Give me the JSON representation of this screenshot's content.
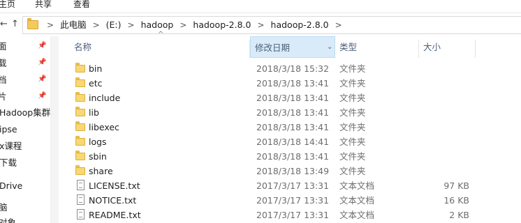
{
  "ribbon": {
    "tabs": [
      "主页",
      "共享",
      "查看"
    ]
  },
  "nav": {
    "back": "←",
    "up": "↑"
  },
  "address": {
    "crumbs": [
      "此电脑",
      "(E:)",
      "hadoop",
      "hadoop-2.8.0",
      "hadoop-2.8.0"
    ],
    "separator": ">"
  },
  "sidebar": {
    "items": [
      "面",
      "载",
      "档",
      "片",
      "Hadoop集群",
      "ipse",
      "x课程",
      "下载",
      "Drive",
      "脑",
      "对象"
    ],
    "pin_glyph": "📌"
  },
  "columns": {
    "name": "名称",
    "date": "修改日期",
    "type": "类型",
    "size": "大小",
    "sort_glyph": "^",
    "dropdown_glyph": "⌄"
  },
  "files": [
    {
      "name": "bin",
      "date": "2018/3/18 15:32",
      "type": "文件夹",
      "size": "",
      "kind": "folder"
    },
    {
      "name": "etc",
      "date": "2018/3/18 13:41",
      "type": "文件夹",
      "size": "",
      "kind": "folder"
    },
    {
      "name": "include",
      "date": "2018/3/18 13:41",
      "type": "文件夹",
      "size": "",
      "kind": "folder"
    },
    {
      "name": "lib",
      "date": "2018/3/18 13:41",
      "type": "文件夹",
      "size": "",
      "kind": "folder"
    },
    {
      "name": "libexec",
      "date": "2018/3/18 13:41",
      "type": "文件夹",
      "size": "",
      "kind": "folder"
    },
    {
      "name": "logs",
      "date": "2018/3/18 14:41",
      "type": "文件夹",
      "size": "",
      "kind": "folder"
    },
    {
      "name": "sbin",
      "date": "2018/3/18 13:41",
      "type": "文件夹",
      "size": "",
      "kind": "folder"
    },
    {
      "name": "share",
      "date": "2018/3/18 13:49",
      "type": "文件夹",
      "size": "",
      "kind": "folder"
    },
    {
      "name": "LICENSE.txt",
      "date": "2017/3/17 13:31",
      "type": "文本文档",
      "size": "97 KB",
      "kind": "file"
    },
    {
      "name": "NOTICE.txt",
      "date": "2017/3/17 13:31",
      "type": "文本文档",
      "size": "16 KB",
      "kind": "file"
    },
    {
      "name": "README.txt",
      "date": "2017/3/17 13:31",
      "type": "文本文档",
      "size": "2 KB",
      "kind": "file"
    }
  ]
}
